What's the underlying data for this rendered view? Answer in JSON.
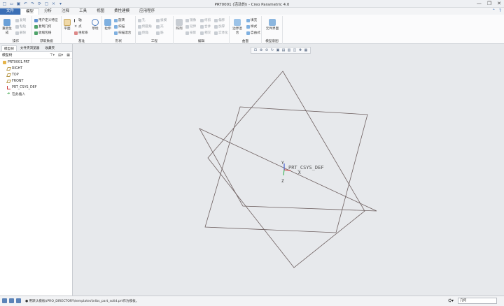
{
  "window": {
    "title": "PRT0001 (活动的) - Creo Parametric 4.0",
    "controls": [
      "—",
      "❐",
      "✕"
    ]
  },
  "tabs": [
    {
      "label": "文件"
    },
    {
      "label": "模型"
    },
    {
      "label": "分析"
    },
    {
      "label": "注释"
    },
    {
      "label": "工具"
    },
    {
      "label": "视图"
    },
    {
      "label": "柔性建模"
    },
    {
      "label": "应用程序"
    }
  ],
  "ribbon": {
    "operations": {
      "label": "操作",
      "regen": "重新生成",
      "copy": "复制",
      "paste": "粘贴",
      "delete": "删除"
    },
    "get_data": {
      "label": "获取数据",
      "udf": "用户定义特征",
      "copy_geom": "复制几何",
      "shrinkwrap": "收缩包络"
    },
    "datum": {
      "label": "基准",
      "plane": "平面",
      "axis": "轴",
      "point": "点",
      "csys": "坐标系",
      "sketch": "草绘"
    },
    "shapes": {
      "label": "形状",
      "extrude": "拉伸",
      "revolve": "旋转",
      "sweep": "扫描",
      "swept_blend": "扫描混合"
    },
    "engineering": {
      "label": "工程",
      "hole": "孔",
      "round": "倒圆角",
      "chamfer": "倒角",
      "draft": "拔模",
      "shell": "壳",
      "rib": "筋"
    },
    "editing": {
      "label": "编辑",
      "pattern": "阵列",
      "mirror": "镜像",
      "extend": "延伸",
      "project": "投影",
      "trim": "修剪",
      "merge": "合并",
      "intersect": "相交",
      "offset": "偏移",
      "thicken": "加厚",
      "solidify": "实体化"
    },
    "surfaces": {
      "label": "曲面",
      "fill": "填充",
      "style": "样式",
      "boundary_blend": "边界混合",
      "freestyle": "自由式"
    },
    "model_intent": {
      "label": "模型意图",
      "component_interface": "元件界面"
    }
  },
  "panel": {
    "tabs": [
      "模型树",
      "文件夹浏览器",
      "收藏夹"
    ],
    "tree_header": "模型树",
    "tree": [
      {
        "label": "PRT0001.PRT",
        "icon": "part-icon"
      },
      {
        "label": "RIGHT",
        "icon": "datum-plane-icon"
      },
      {
        "label": "TOP",
        "icon": "datum-plane-icon"
      },
      {
        "label": "FRONT",
        "icon": "datum-plane-icon"
      },
      {
        "label": "PRT_CSYS_DEF",
        "icon": "csys-icon"
      },
      {
        "label": "在此插入",
        "icon": "insert-here-icon"
      }
    ]
  },
  "viewport": {
    "csys_label": "PRT_CSYS_DEF",
    "axis_x": "X",
    "axis_y": "Y",
    "axis_z": "Z",
    "toolbar": [
      "refit-icon",
      "zoom-in-icon",
      "zoom-out-icon",
      "repaint-icon",
      "view-manager-icon",
      "saved-views-icon",
      "display-style-icon",
      "datum-display-icon",
      "spin-center-icon",
      "annotation-display-icon"
    ]
  },
  "status": {
    "message": "● 用默认模板$PRO_DIRECTORY\\templates\\inlbs_part_solid.prt作为模板。",
    "filter_value": "几何"
  },
  "colors": {
    "file_tab": "#3b6fb6",
    "datum_plane": "#6d5f5f",
    "csys_red": "#cc2222",
    "csys_green": "#22aa44",
    "csys_blue": "#2244cc"
  }
}
